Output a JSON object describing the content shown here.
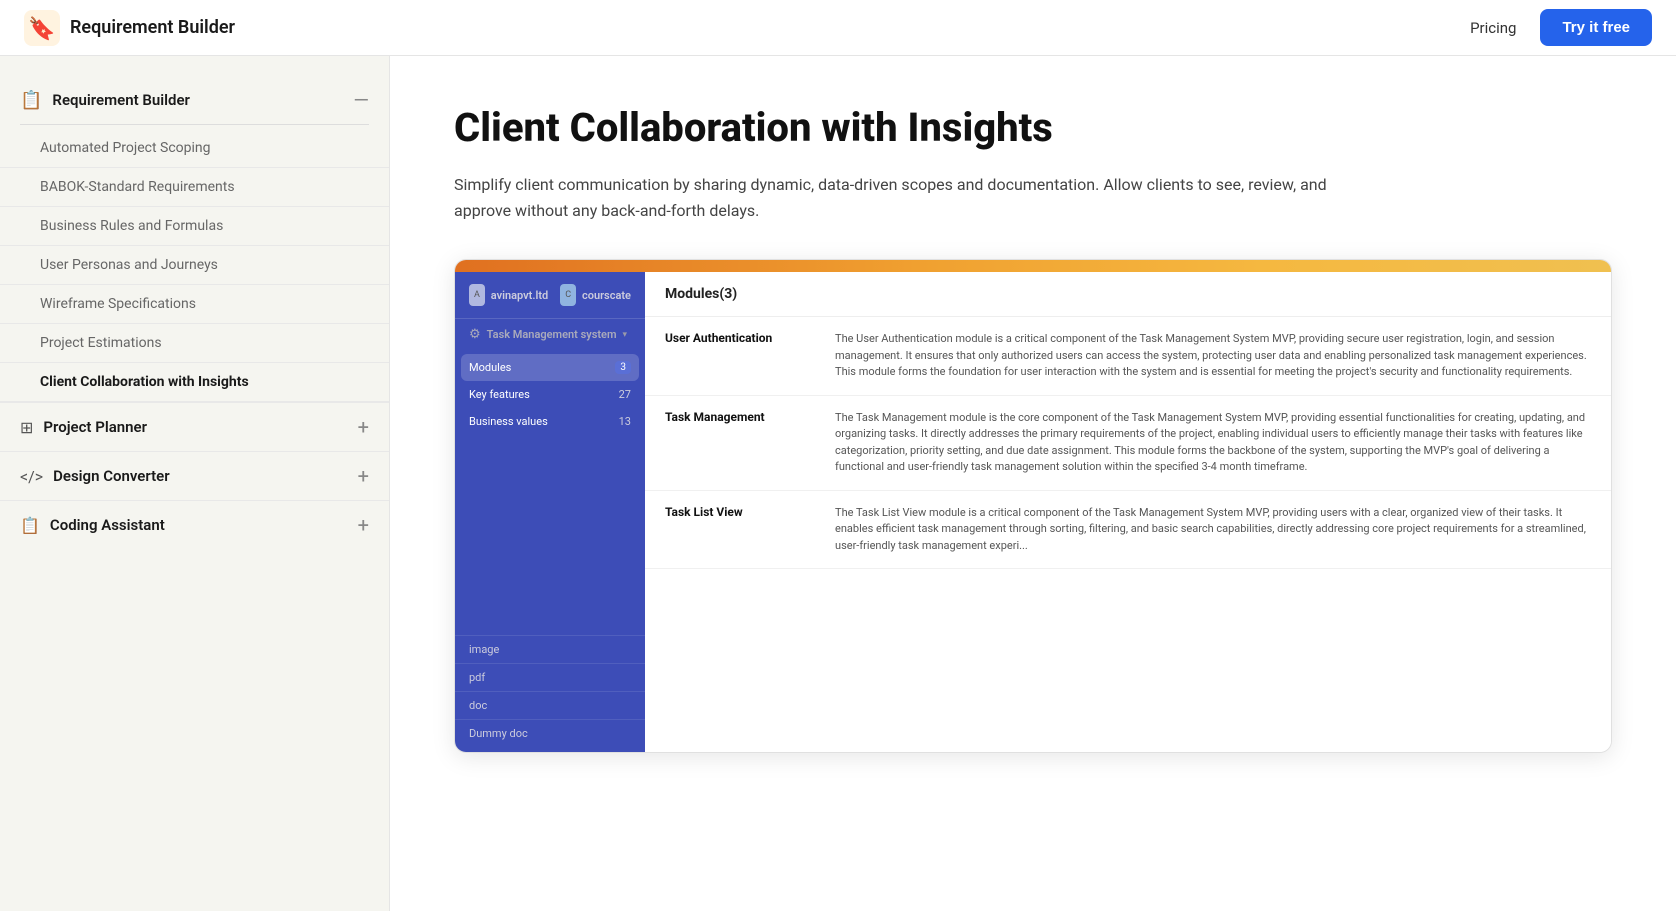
{
  "topnav": {
    "logo_alt": "Requirement Builder logo",
    "title": "Requirement Builder",
    "pricing_label": "Pricing",
    "cta_label": "Try it free"
  },
  "sidebar": {
    "header_title": "Requirement Builder",
    "header_icon": "📋",
    "items": [
      {
        "id": "automated-project-scoping",
        "label": "Automated Project Scoping",
        "active": false
      },
      {
        "id": "babok-standard-requirements",
        "label": "BABOK-Standard Requirements",
        "active": false
      },
      {
        "id": "business-rules-and-formulas",
        "label": "Business Rules and Formulas",
        "active": false
      },
      {
        "id": "user-personas-and-journeys",
        "label": "User Personas and Journeys",
        "active": false
      },
      {
        "id": "wireframe-specifications",
        "label": "Wireframe Specifications",
        "active": false
      },
      {
        "id": "project-estimations",
        "label": "Project Estimations",
        "active": false
      },
      {
        "id": "client-collaboration-with-insights",
        "label": "Client Collaboration with Insights",
        "active": true
      }
    ],
    "sections": [
      {
        "id": "project-planner",
        "label": "Project Planner",
        "icon": "⊞"
      },
      {
        "id": "design-converter",
        "label": "Design Converter",
        "icon": "</>"
      },
      {
        "id": "coding-assistant",
        "label": "Coding Assistant",
        "icon": "📋"
      }
    ]
  },
  "main": {
    "title": "Client Collaboration with Insights",
    "description": "Simplify client communication by sharing dynamic, data-driven scopes and documentation. Allow clients to see, review, and approve without any back-and-forth delays.",
    "screenshot": {
      "left_header_brand1": "avinapvt.ltd",
      "left_header_brand2": "courscate",
      "project_name": "Task Management system",
      "menu_items": [
        {
          "label": "Modules",
          "count": "3",
          "active": true
        },
        {
          "label": "Key features",
          "count": "27",
          "active": false
        },
        {
          "label": "Business values",
          "count": "13",
          "active": false
        }
      ],
      "right_header": "Modules(3)",
      "modules": [
        {
          "name": "User Authentication",
          "description": "The User Authentication module is a critical component of the Task Management System MVP, providing secure user registration, login, and session management. It ensures that only authorized users can access the system, protecting user data and enabling personalized task management experiences. This module forms the foundation for user interaction with the system and is essential for meeting the project's security and functionality requirements."
        },
        {
          "name": "Task Management",
          "description": "The Task Management module is the core component of the Task Management System MVP, providing essential functionalities for creating, updating, and organizing tasks. It directly addresses the primary requirements of the project, enabling individual users to efficiently manage their tasks with features like categorization, priority setting, and due date assignment. This module forms the backbone of the system, supporting the MVP's goal of delivering a functional and user-friendly task management solution within the specified 3-4 month timeframe."
        },
        {
          "name": "Task List View",
          "description": "The Task List View module is a critical component of the Task Management System MVP, providing users with a clear, organized view of their tasks. It enables efficient task management through sorting, filtering, and basic search capabilities, directly addressing core project requirements for a streamlined, user-friendly task management experi..."
        }
      ],
      "files": [
        {
          "label": "image"
        },
        {
          "label": "pdf"
        },
        {
          "label": "doc"
        },
        {
          "label": "Dummy doc"
        }
      ]
    }
  }
}
